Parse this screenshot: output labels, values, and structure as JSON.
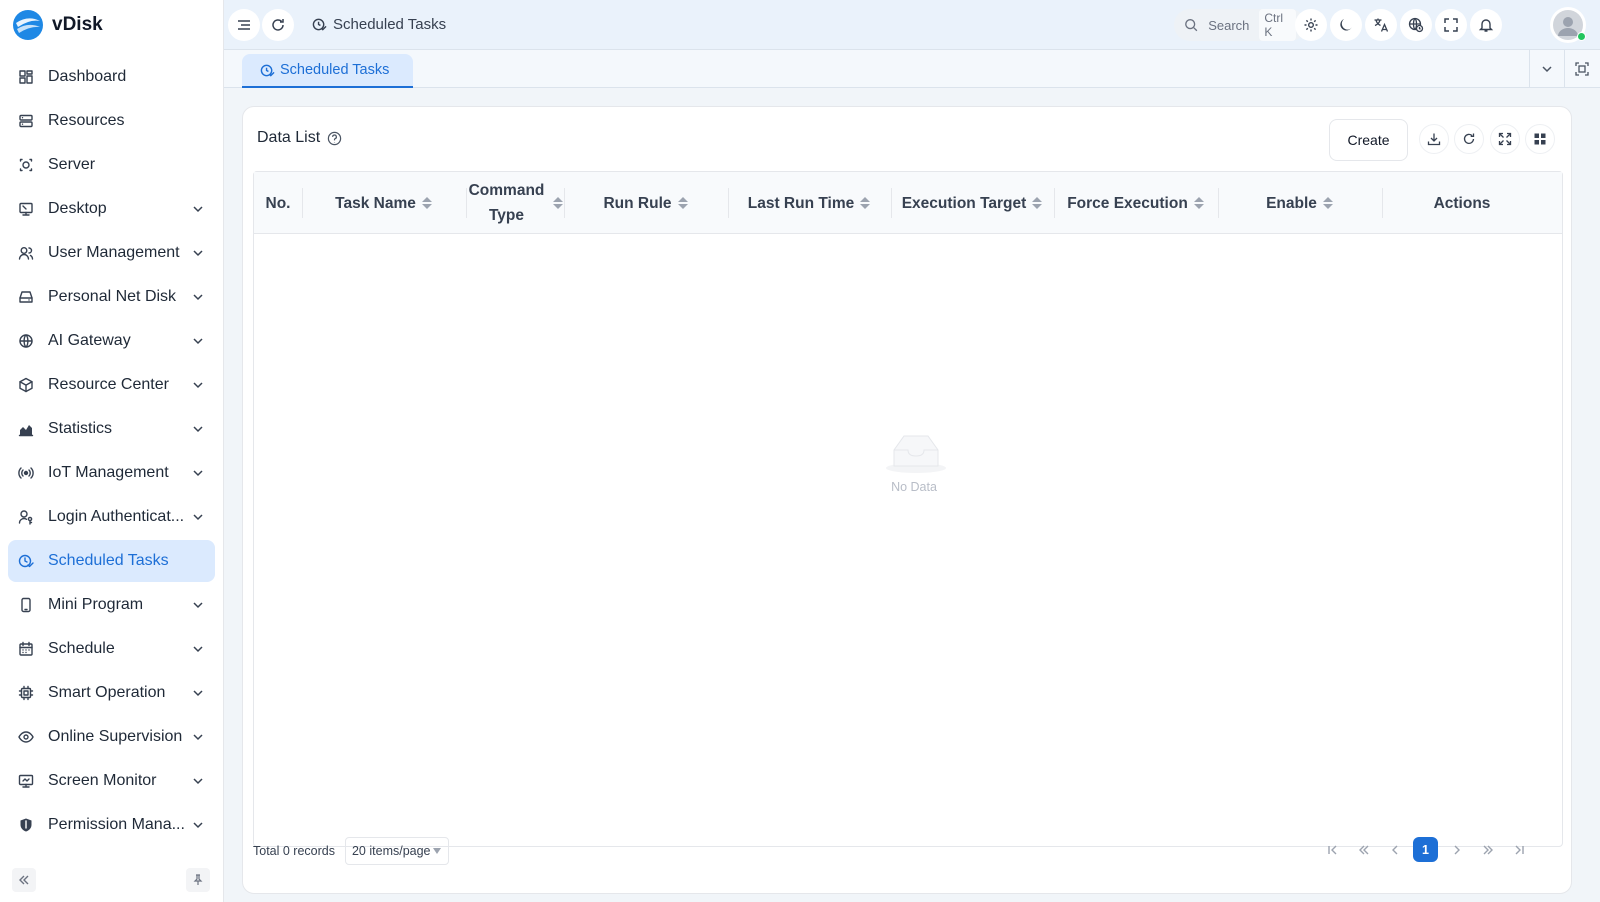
{
  "app": {
    "name": "vDisk"
  },
  "sidebar": {
    "items": [
      {
        "label": "Dashboard",
        "icon": "dashboard-icon",
        "expandable": false
      },
      {
        "label": "Resources",
        "icon": "resources-icon",
        "expandable": false
      },
      {
        "label": "Server",
        "icon": "server-icon",
        "expandable": false
      },
      {
        "label": "Desktop",
        "icon": "desktop-icon",
        "expandable": true
      },
      {
        "label": "User Management",
        "icon": "users-icon",
        "expandable": true
      },
      {
        "label": "Personal Net Disk",
        "icon": "disk-icon",
        "expandable": true
      },
      {
        "label": "AI Gateway",
        "icon": "globe-icon",
        "expandable": true
      },
      {
        "label": "Resource Center",
        "icon": "cube-icon",
        "expandable": true
      },
      {
        "label": "Statistics",
        "icon": "chart-icon",
        "expandable": true
      },
      {
        "label": "IoT Management",
        "icon": "broadcast-icon",
        "expandable": true
      },
      {
        "label": "Login Authenticat...",
        "icon": "user-key-icon",
        "expandable": true
      },
      {
        "label": "Scheduled Tasks",
        "icon": "clock-check-icon",
        "expandable": false,
        "active": true
      },
      {
        "label": "Mini Program",
        "icon": "phone-icon",
        "expandable": true
      },
      {
        "label": "Schedule",
        "icon": "calendar-icon",
        "expandable": true
      },
      {
        "label": "Smart Operation",
        "icon": "chip-icon",
        "expandable": true
      },
      {
        "label": "Online Supervision",
        "icon": "eye-icon",
        "expandable": true
      },
      {
        "label": "Screen Monitor",
        "icon": "monitor-icon",
        "expandable": true
      },
      {
        "label": "Permission Mana...",
        "icon": "shield-icon",
        "expandable": true
      }
    ]
  },
  "header": {
    "breadcrumb": "Scheduled Tasks",
    "search_placeholder": "Search",
    "search_shortcut": "Ctrl K"
  },
  "tabs": [
    {
      "label": "Scheduled Tasks",
      "active": true
    }
  ],
  "content": {
    "title": "Data List",
    "create_label": "Create",
    "columns": [
      {
        "label": "No.",
        "sortable": false
      },
      {
        "label": "Task Name",
        "sortable": true
      },
      {
        "label": "Command Type",
        "sortable": true
      },
      {
        "label": "Run Rule",
        "sortable": true
      },
      {
        "label": "Last Run Time",
        "sortable": true
      },
      {
        "label": "Execution Target",
        "sortable": true
      },
      {
        "label": "Force Execution",
        "sortable": true
      },
      {
        "label": "Enable",
        "sortable": true
      },
      {
        "label": "Actions",
        "sortable": false
      }
    ],
    "empty_text": "No Data"
  },
  "pagination": {
    "total_text": "Total 0 records",
    "page_size": "20 items/page",
    "current_page": "1"
  },
  "colors": {
    "accent": "#1d6fd6",
    "active_bg": "#dbeafe",
    "header_bg": "#eaf2fb"
  }
}
